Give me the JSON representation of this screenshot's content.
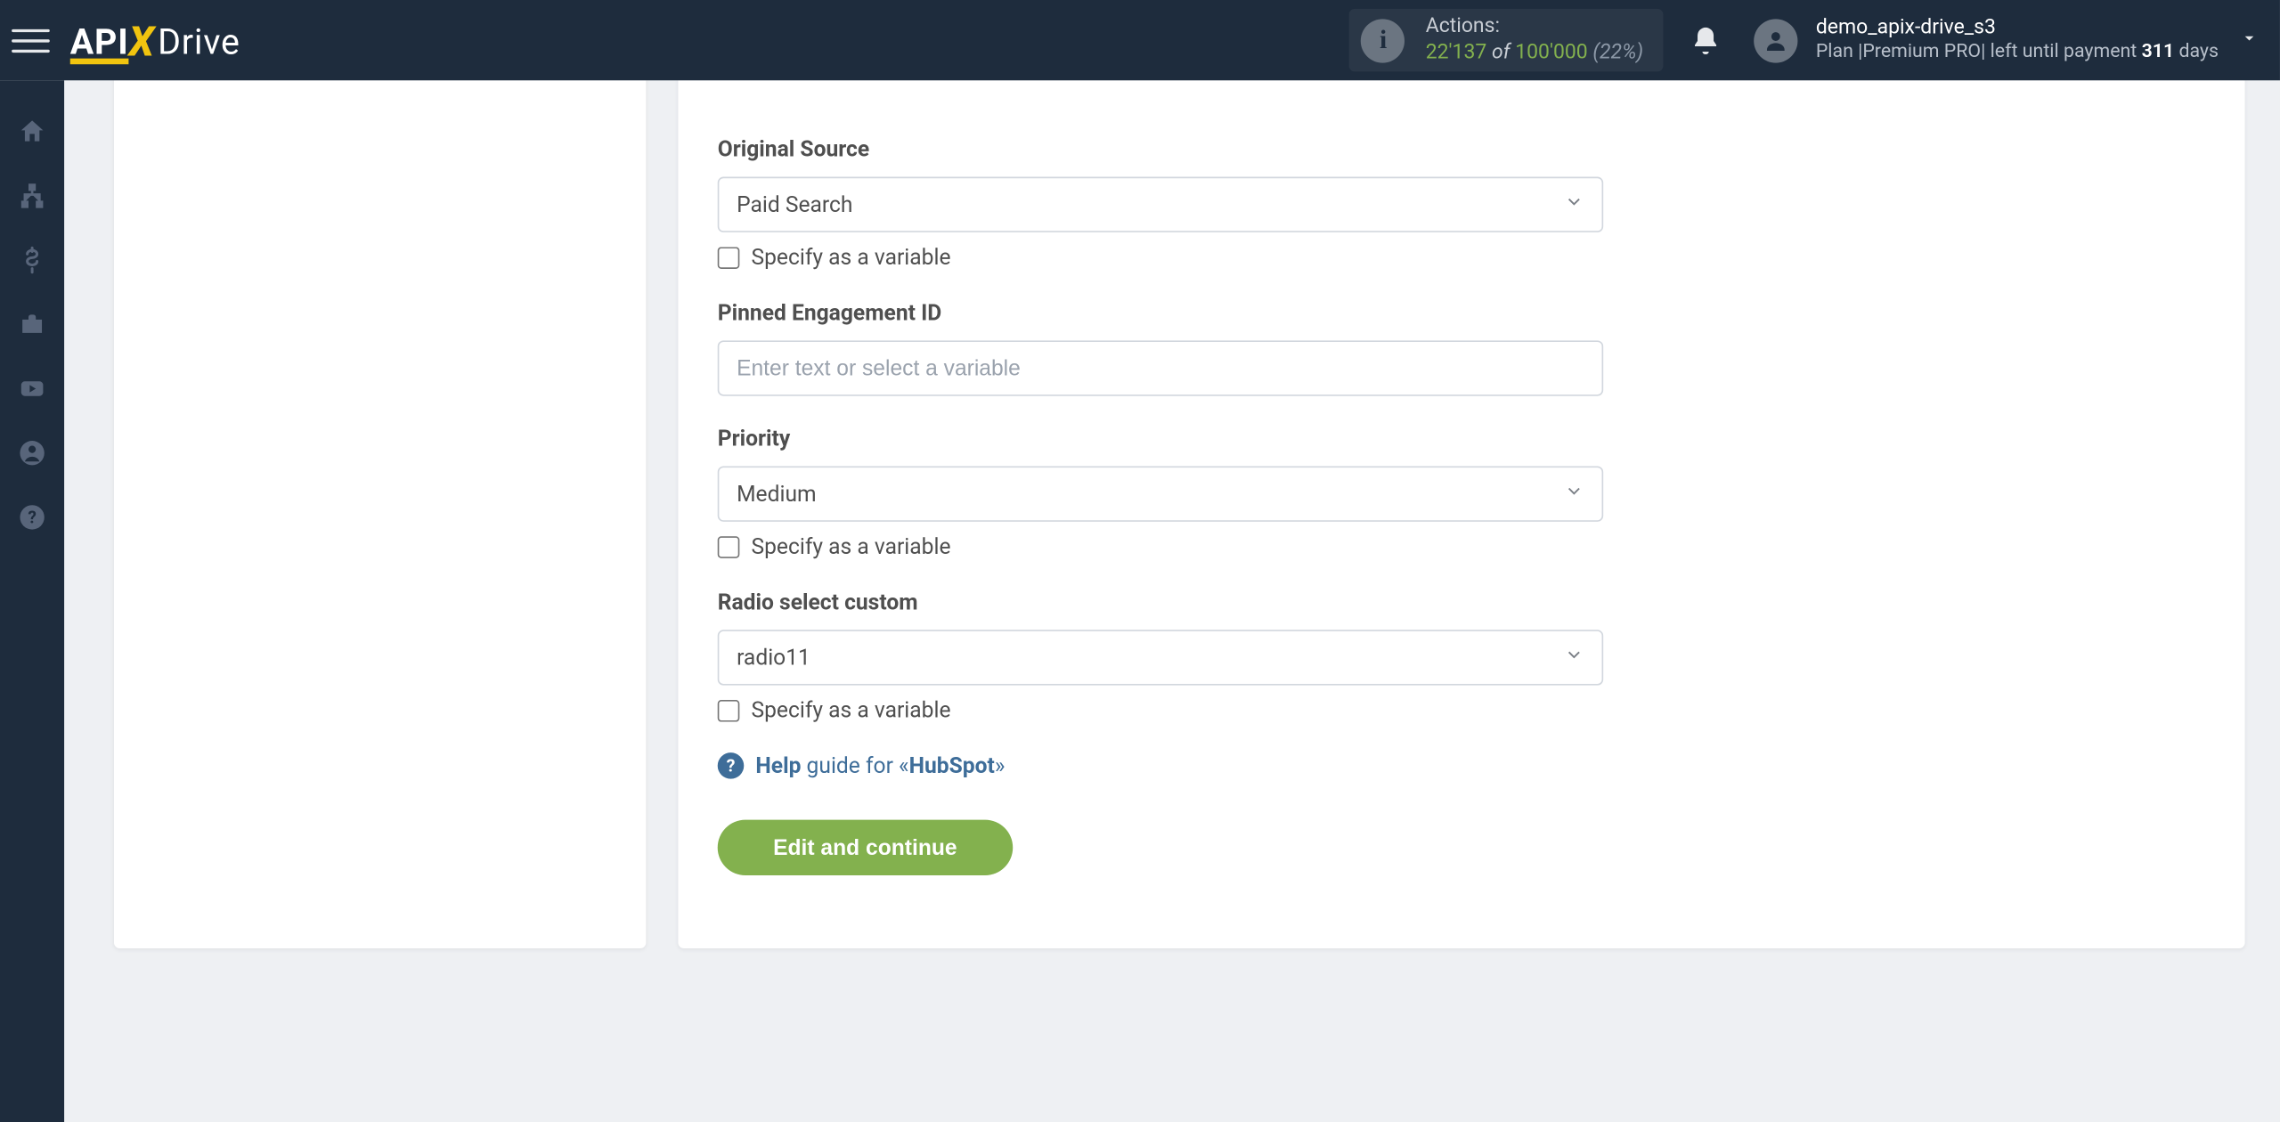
{
  "header": {
    "logo_api": "API",
    "logo_drive": "Drive",
    "actions_label": "Actions:",
    "actions_used": "22'137",
    "actions_of": "of",
    "actions_total": "100'000",
    "actions_pct": "(22%)",
    "username": "demo_apix-drive_s3",
    "plan_prefix": "Plan |",
    "plan_name": "Premium PRO",
    "plan_suffix": "| left until payment",
    "days_num": "311",
    "days_word": "days"
  },
  "form": {
    "original_source": {
      "label": "Original Source",
      "value": "Paid Search",
      "specify": "Specify as a variable"
    },
    "pinned": {
      "label": "Pinned Engagement ID",
      "placeholder": "Enter text or select a variable"
    },
    "priority": {
      "label": "Priority",
      "value": "Medium",
      "specify": "Specify as a variable"
    },
    "radio": {
      "label": "Radio select custom",
      "value": "radio11",
      "specify": "Specify as a variable"
    },
    "help_bold": "Help",
    "help_rest": " guide for «",
    "help_product": "HubSpot",
    "help_close": "»",
    "submit": "Edit and continue"
  }
}
